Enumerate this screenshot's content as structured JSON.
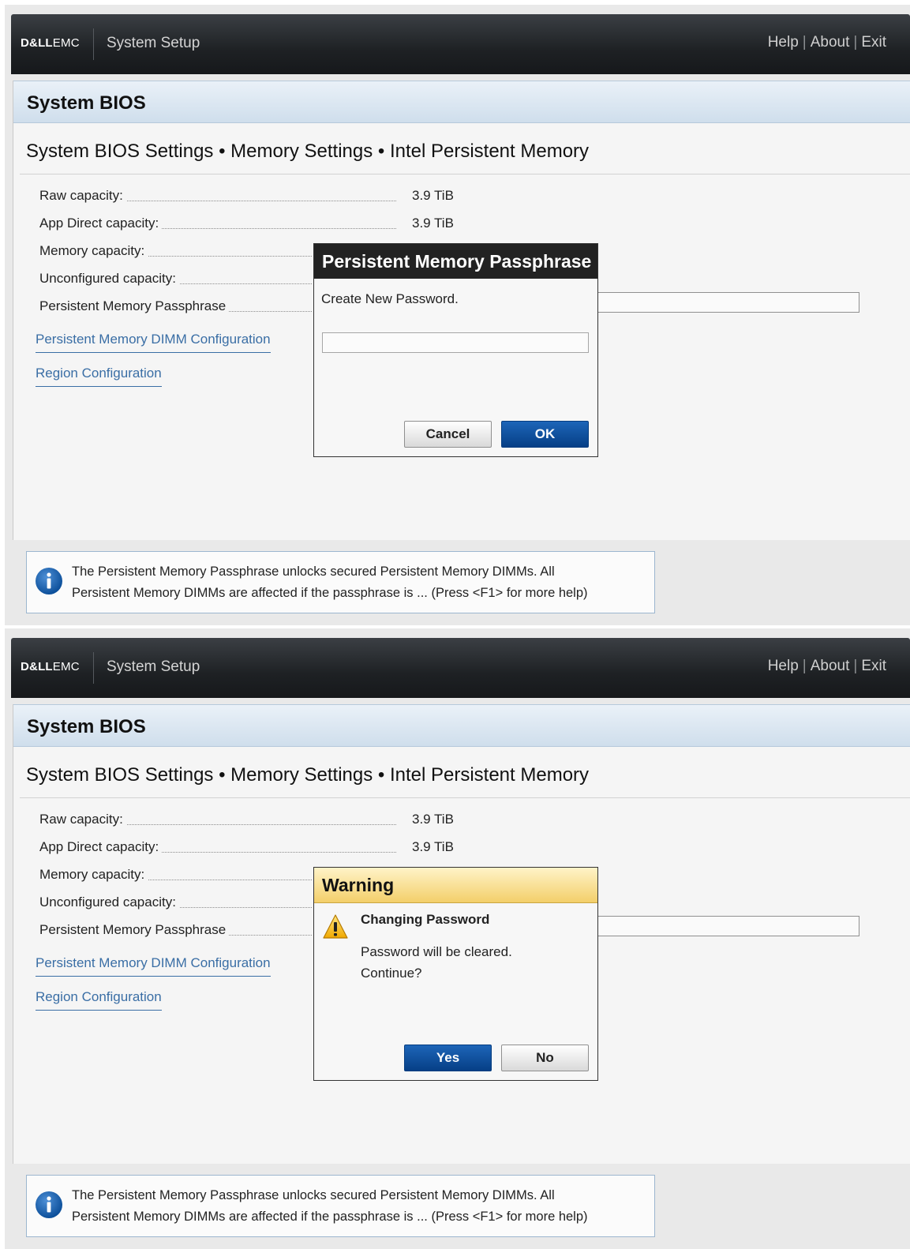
{
  "screens": [
    {
      "header": {
        "brand_bold": "D&LL",
        "brand_light": "EMC",
        "app_title": "System Setup",
        "links": [
          "Help",
          "About",
          "Exit"
        ]
      },
      "panel_title": "System BIOS",
      "breadcrumb": "System BIOS Settings • Memory Settings • Intel Persistent Memory",
      "fields": [
        {
          "label": "Raw capacity:",
          "value": "3.9 TiB"
        },
        {
          "label": "App Direct capacity:",
          "value": "3.9 TiB"
        },
        {
          "label": "Memory capacity:",
          "value": ""
        },
        {
          "label": "Unconfigured capacity:",
          "value": ""
        },
        {
          "label": "Persistent Memory Passphrase",
          "value": ""
        }
      ],
      "links": [
        "Persistent Memory DIMM Configuration",
        "Region Configuration"
      ],
      "dialog": {
        "type": "password",
        "title": "Persistent Memory Passphrase",
        "message": "Create New Password.",
        "input_value": "",
        "buttons": [
          "Cancel",
          "OK"
        ]
      },
      "info": {
        "line1": "The Persistent Memory Passphrase unlocks secured Persistent Memory DIMMs. All",
        "line2": "Persistent Memory DIMMs are affected if the passphrase is ... (Press <F1> for more help)"
      }
    },
    {
      "header": {
        "brand_bold": "D&LL",
        "brand_light": "EMC",
        "app_title": "System Setup",
        "links": [
          "Help",
          "About",
          "Exit"
        ]
      },
      "panel_title": "System BIOS",
      "breadcrumb": "System BIOS Settings • Memory Settings • Intel Persistent Memory",
      "fields": [
        {
          "label": "Raw capacity:",
          "value": "3.9 TiB"
        },
        {
          "label": "App Direct capacity:",
          "value": "3.9 TiB"
        },
        {
          "label": "Memory capacity:",
          "value": ""
        },
        {
          "label": "Unconfigured capacity:",
          "value": ""
        },
        {
          "label": "Persistent Memory Passphrase",
          "value": ""
        }
      ],
      "links": [
        "Persistent Memory DIMM Configuration",
        "Region Configuration"
      ],
      "dialog": {
        "type": "warning",
        "title": "Warning",
        "heading": "Changing Password",
        "message_line1": "Password will be cleared.",
        "message_line2": "Continue?",
        "buttons": [
          "Yes",
          "No"
        ],
        "icon": "warning-triangle-icon"
      },
      "info": {
        "line1": "The Persistent Memory Passphrase unlocks secured Persistent Memory DIMMs. All",
        "line2": "Persistent Memory DIMMs are affected if the passphrase is ... (Press <F1> for more help)"
      }
    }
  ],
  "colors": {
    "link_blue": "#3a6ea5",
    "button_blue": "#0a4a96",
    "warning_yellow": "#f3cf6a",
    "header_dark": "#1e2124"
  }
}
